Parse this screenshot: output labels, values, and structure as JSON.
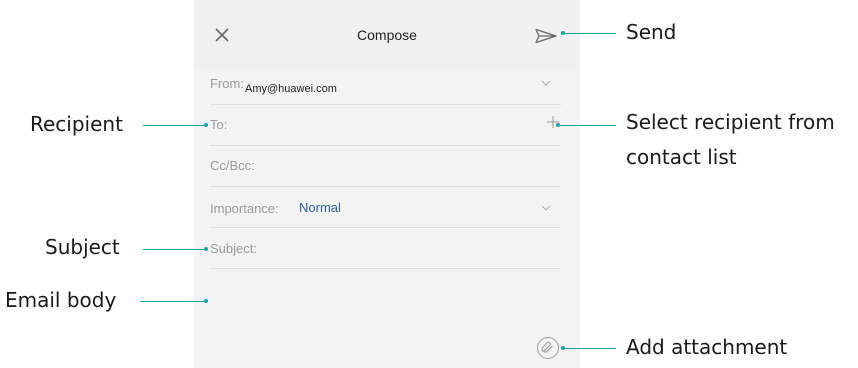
{
  "compose": {
    "title": "Compose",
    "from_label": "From:",
    "from_value": "Amy@huawei.com",
    "to_label": "To:",
    "ccbcc_label": "Cc/Bcc:",
    "importance_label": "Importance:",
    "importance_value": "Normal",
    "subject_label": "Subject:"
  },
  "annotations": {
    "send": "Send",
    "recipient": "Recipient",
    "select_recipient_line1": "Select recipient from",
    "select_recipient_line2": "contact list",
    "subject": "Subject",
    "email_body": "Email body",
    "add_attachment": "Add attachment"
  },
  "colors": {
    "accent_line": "#1aa3a6",
    "importance_value": "#2b5ea8"
  }
}
